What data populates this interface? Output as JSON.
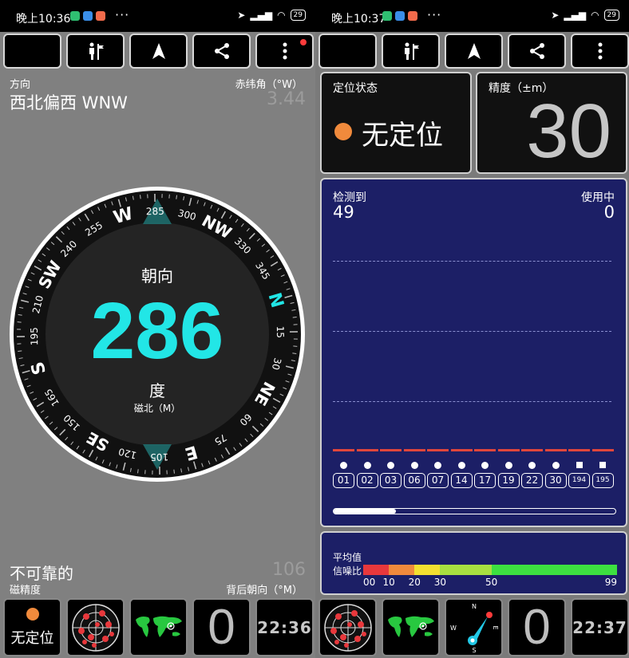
{
  "left": {
    "statusbar": {
      "time": "晚上10:36",
      "more": "···",
      "battery": "29"
    },
    "toolbar": {
      "has_notification": true
    },
    "direction": {
      "label": "方向",
      "value": "西北偏西 WNW"
    },
    "declination": {
      "label": "赤纬角（°W）",
      "value": "3.44"
    },
    "compass": {
      "heading": "286",
      "heading_label": "朝向",
      "unit_label": "度",
      "ref_label": "磁北（M）",
      "cardinals": [
        "N",
        "NE",
        "E",
        "SE",
        "S",
        "SW",
        "W",
        "NW"
      ],
      "ticks": [
        "15",
        "30",
        "60",
        "75",
        "105",
        "120",
        "150",
        "165",
        "195",
        "210",
        "240",
        "255",
        "285",
        "300",
        "330",
        "345"
      ]
    },
    "reliability": {
      "value": "不可靠的",
      "label": "磁精度"
    },
    "back_heading": {
      "value": "106",
      "label": "背后朝向（°M）"
    },
    "bottombar": {
      "fix_status": "无定位",
      "count": "0",
      "clock": "22:36"
    }
  },
  "right": {
    "statusbar": {
      "time": "晚上10:37",
      "more": "···",
      "battery": "29"
    },
    "fix": {
      "label": "定位状态",
      "value": "无定位",
      "dot_color": "#f08a3c"
    },
    "accuracy": {
      "label": "精度（±m）",
      "value": "30"
    },
    "satellites": {
      "detected_label": "检测到",
      "detected": "49",
      "in_use_label": "使用中",
      "in_use": "0",
      "prns": [
        "01",
        "02",
        "03",
        "06",
        "07",
        "14",
        "17",
        "19",
        "22",
        "30",
        "194",
        "195"
      ],
      "symbols": [
        "dot",
        "dot",
        "dot",
        "dot",
        "dot",
        "dot",
        "dot",
        "dot",
        "dot",
        "dot",
        "square",
        "square"
      ],
      "scroll_fraction": 0.22
    },
    "snr": {
      "avg_label": "平均值",
      "snr_label": "信噪比",
      "scale_labels": [
        "00",
        "10",
        "20",
        "30",
        "50",
        "99"
      ],
      "segment_colors": [
        "#e8383c",
        "#f08a3c",
        "#f4e030",
        "#a8e040",
        "#3de040"
      ]
    },
    "bottombar": {
      "count": "0",
      "clock": "22:37",
      "compass_letters": [
        "N",
        "E",
        "S",
        "W"
      ]
    }
  },
  "colors": {
    "accent": "#22e6e6",
    "compass_bg": "#242424",
    "sat_bg": "#1c1f66"
  }
}
